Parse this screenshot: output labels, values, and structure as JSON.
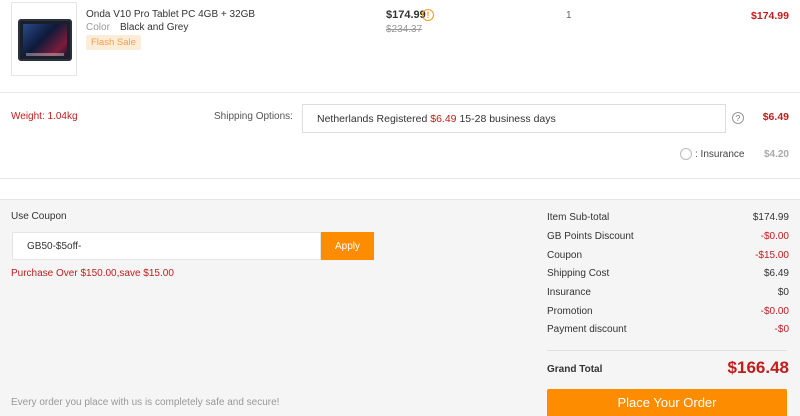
{
  "product": {
    "title": "Onda V10 Pro Tablet PC 4GB + 32GB",
    "color_label": "Color",
    "color_value": "Black and Grey",
    "flash_sale": "Flash Sale",
    "price": "$174.99",
    "old_price": "$234.37",
    "quantity": "1",
    "line_total": "$174.99"
  },
  "shipping": {
    "weight": "Weight: 1.04kg",
    "options_label": "Shipping Options:",
    "method": "Netherlands Registered",
    "method_price": "$6.49",
    "method_days": "15-28 business days",
    "cost": "$6.49",
    "insurance_label": ": Insurance",
    "insurance_cost": "$4.20"
  },
  "coupon": {
    "label": "Use Coupon",
    "value": "GB50-$5off-",
    "apply_label": "Apply",
    "message": "Purchase Over $150.00,save $15.00"
  },
  "summary": {
    "rows": [
      {
        "label": "Item Sub-total",
        "value": "$174.99"
      },
      {
        "label": "GB Points Discount",
        "value": "-$0.00"
      },
      {
        "label": "Coupon",
        "value": "-$15.00"
      },
      {
        "label": "Shipping Cost",
        "value": "$6.49"
      },
      {
        "label": "Insurance",
        "value": "$0"
      },
      {
        "label": "Promotion",
        "value": "-$0.00"
      },
      {
        "label": "Payment discount",
        "value": "-$0"
      }
    ],
    "grand_total_label": "Grand Total",
    "grand_total": "$166.48",
    "place_order_label": "Place Your Order"
  },
  "footer": {
    "secure_text": "Every order you place with us is completely safe and secure!"
  },
  "colors": {
    "accent": "#fe8c00",
    "price_red": "#c21d1d"
  },
  "icons": {
    "price_info": "info-icon",
    "shipping_help": "question-icon"
  }
}
